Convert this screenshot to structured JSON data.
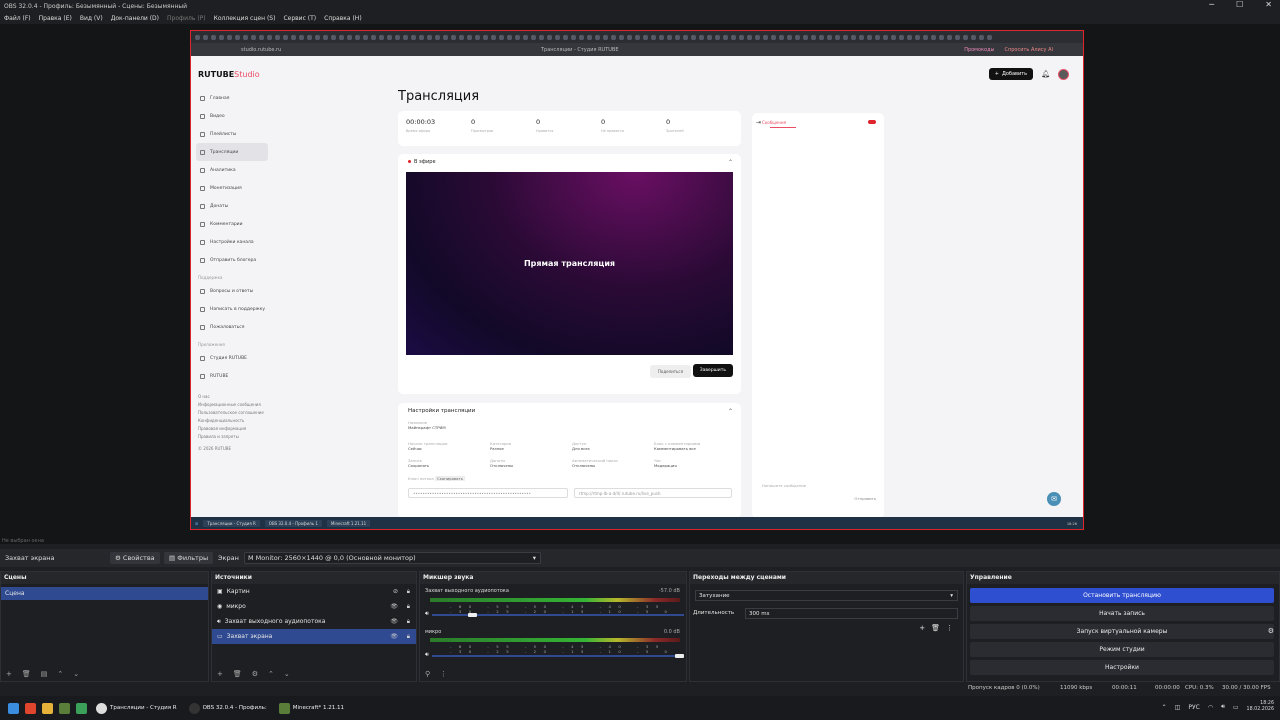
{
  "window": {
    "title": "OBS 32.0.4 - Профиль: Безымянный - Сцены: Безымянный",
    "controls": [
      "─",
      "☐",
      "✕"
    ]
  },
  "menu": {
    "items": [
      "Файл (F)",
      "Правка (E)",
      "Вид (V)",
      "Док-панели (D)"
    ],
    "disabled": "Профиль (P)",
    "items2": [
      "Коллекция сцен (S)",
      "Сервис (T)",
      "Справка (H)"
    ]
  },
  "browser": {
    "url": "studio.rutube.ru",
    "tab_title": "Трансляции - Студия RUTUBE",
    "right": [
      "Промокоды",
      "Спросить Алису AI"
    ]
  },
  "page": {
    "logo": "RUTUBE",
    "logo_accent": "Studio",
    "add_button": "Добавить",
    "sidebar": [
      "Главная",
      "Видео",
      "Плейлисты",
      "Трансляции",
      "Аналитика",
      "Монетизация",
      "Донаты",
      "Комментарии",
      "Настройки канала",
      "Отправить блогера"
    ],
    "sidebar_active": 3,
    "support_title": "Поддержка",
    "support": [
      "Вопросы и ответы",
      "Написать в поддержку",
      "Пожаловаться"
    ],
    "apps_title": "Приложения",
    "apps": [
      "Студия RUTUBE",
      "RUTUBE"
    ],
    "footer": [
      "О нас",
      "Информационные сообщения",
      "Пользовательское соглашение",
      "Конфиденциальность",
      "Правовая информация",
      "Правила и запреты"
    ],
    "footer_last": "© 2026 RUTUBE",
    "title": "Трансляция",
    "stats": [
      {
        "v": "00:00:03",
        "l": "Время эфира"
      },
      {
        "v": "0",
        "l": "Просмотров"
      },
      {
        "v": "0",
        "l": "Нравится"
      },
      {
        "v": "0",
        "l": "Не нравится"
      },
      {
        "v": "0",
        "l": "Зрителей"
      }
    ],
    "live_label": "В эфире",
    "video_title": "Прямая трансляция",
    "share": "Поделиться",
    "end": "Завершить",
    "settings_title": "Настройки трансляции",
    "settings": {
      "name_l": "Название",
      "name_v": "Майнкрафт СТРИМ",
      "stream_l": "Начало трансляции",
      "stream_v": "Сейчас",
      "cat_l": "Категория",
      "cat_v": "Разное",
      "access_l": "Доступ",
      "access_v": "Для всех",
      "adv_l": "Блок с комментариями",
      "adv_v": "Комментировать все",
      "rec_l": "Запись",
      "rec_v": "Сохранять",
      "chat_l": "Донаты",
      "chat_v": "Отключены",
      "age_l": "Автоматический показ",
      "age_v": "Отключены",
      "ch_l": "Чат",
      "ch_v": "Модерация",
      "key_l": "Ключ потока",
      "key_badge": "Скопировать",
      "url_l": "Сервер",
      "url_v": "rtmp://rtmp-lb-a.d/4/.rutube.ru/live_push"
    },
    "chat": {
      "tab": "Сообщения",
      "input_placeholder": "Напишите сообщение",
      "send": "Отправить"
    },
    "taskbar_items": [
      "Трансляции - Студия R",
      "OBS 32.0.4 - Профиль 1",
      "Minecraft 1.21.11"
    ]
  },
  "preview_status": "Не выбран окна",
  "toolbar": {
    "source": "Захват экрана",
    "properties": "Свойства",
    "filters": "Фильтры",
    "screen_label": "Экран",
    "monitor": "M Monitor: 2560×1440 @ 0,0 (Основной монитор)"
  },
  "scenes": {
    "title": "Сцены",
    "items": [
      "Сцена"
    ]
  },
  "sources": {
    "title": "Источники",
    "items": [
      "Картин",
      "микро",
      "Захват выходного аудиопотока",
      "Захват экрана"
    ],
    "selected": 3
  },
  "mixer": {
    "title": "Микшер звука",
    "channels": [
      {
        "name": "Захват выходного аудиопотока",
        "db": "-57.0 dB",
        "ticks": "-60 -55 -50 -45 -40 -35 -30 -25 -20 -15 -10 -5 0"
      },
      {
        "name": "микро",
        "db": "0.0 dB",
        "ticks": "-60 -55 -50 -45 -40 -35 -30 -25 -20 -15 -10 -5 0"
      }
    ],
    "levels": [
      0.15,
      1.0
    ]
  },
  "transitions": {
    "title": "Переходы между сценами",
    "type": "Затухание",
    "duration_label": "Длительность",
    "duration": "300 ms"
  },
  "controls": {
    "title": "Управление",
    "items": [
      "Остановить трансляцию",
      "Начать запись",
      "Запуск виртуальной камеры",
      "Режим студии",
      "Настройки"
    ]
  },
  "status": {
    "dropped": "Пропуск кадров 0 (0.0%)",
    "bitrate": "11090 kbps",
    "live": "00:00:11",
    "rec": "00:00:00",
    "cpu": "CPU: 0.3%",
    "fps": "30.00 / 30.00 FPS"
  },
  "taskbar": {
    "items": [
      "Трансляции - Студия R",
      "OBS 32.0.4 - Профиль:",
      "Minecraft* 1.21.11"
    ],
    "lang": "РУС",
    "time": "18:26",
    "date": "18.02.2026"
  },
  "colors": {
    "accent": "#2f4fd1",
    "selection": "#2f4a91",
    "capture_border": "#e0242c",
    "rutube_red": "#e94e65"
  }
}
